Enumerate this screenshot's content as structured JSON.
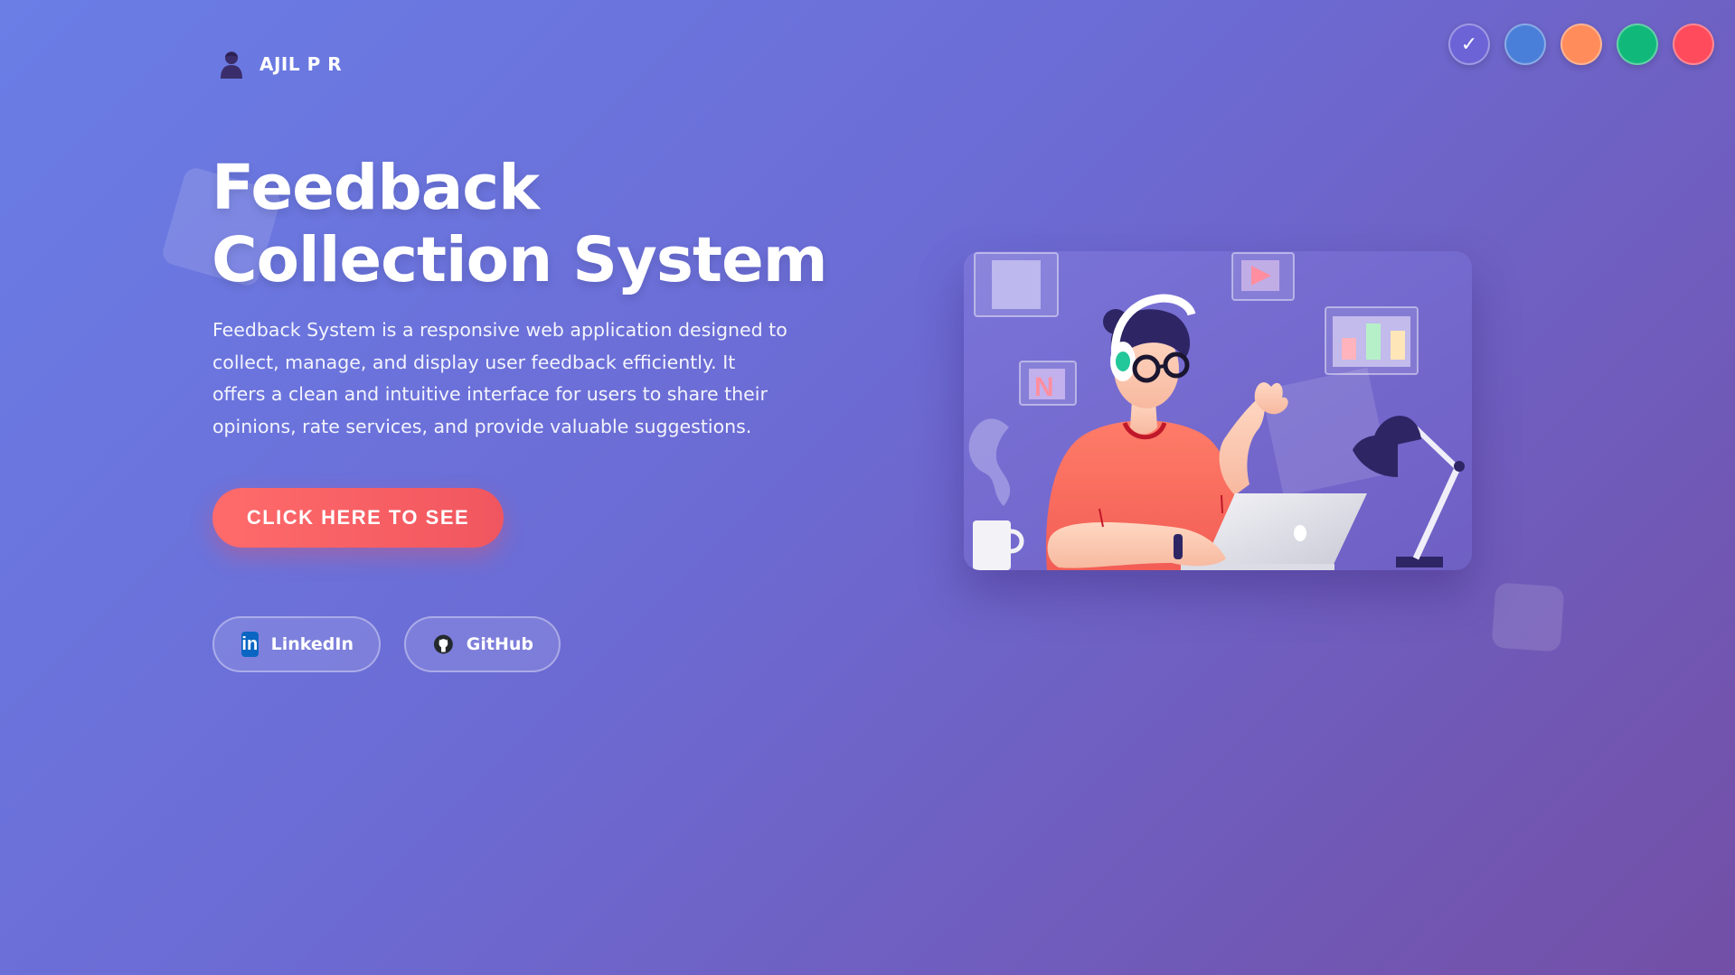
{
  "brand": {
    "name": "AJIL P R",
    "icon": "user-avatar-icon"
  },
  "theme_swatches": [
    {
      "name": "purple",
      "color": "#6c63d6",
      "selected": true,
      "check": "✓"
    },
    {
      "name": "blue",
      "color": "#4a7fd9",
      "selected": false
    },
    {
      "name": "orange",
      "color": "#ff8c5a",
      "selected": false
    },
    {
      "name": "green",
      "color": "#10b97a",
      "selected": false
    },
    {
      "name": "red",
      "color": "#ff4b5c",
      "selected": false
    }
  ],
  "hero": {
    "title": "Feedback Collection System",
    "description": "Feedback System is a responsive web application designed to collect, manage, and display user feedback efficiently. It offers a clean and intuitive interface for users to share their opinions, rate services, and provide valuable suggestions.",
    "cta_label": "CLICK HERE TO SEE"
  },
  "social": {
    "linkedin": {
      "label": "LinkedIn",
      "icon": "linkedin-icon",
      "icon_text": "in"
    },
    "github": {
      "label": "GitHub",
      "icon": "github-icon"
    }
  },
  "colors": {
    "cta": "#ff6b6b",
    "shirt": "#ff7a6b",
    "accent_green": "#22c79a"
  }
}
